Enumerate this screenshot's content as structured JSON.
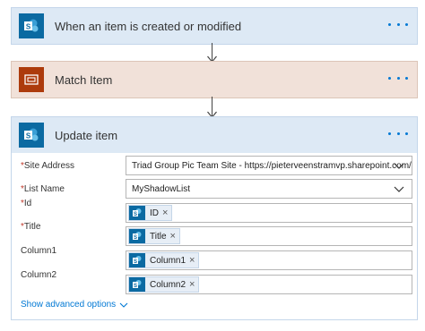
{
  "steps": {
    "trigger": {
      "title": "When an item is created or modified",
      "icon": "sharepoint-icon"
    },
    "match": {
      "title": "Match Item",
      "icon": "scope-icon"
    },
    "update": {
      "title": "Update item",
      "icon": "sharepoint-icon",
      "fields": {
        "site_address": {
          "label": "Site Address",
          "required": "*",
          "value": "Triad Group Pic Team Site - https://pieterveenstramvp.sharepoint.com/"
        },
        "list_name": {
          "label": "List Name",
          "required": "*",
          "value": "MyShadowList"
        },
        "id": {
          "label": "Id",
          "required": "*",
          "token": "ID"
        },
        "title": {
          "label": "Title",
          "required": "*",
          "token": "Title"
        },
        "column1": {
          "label": "Column1",
          "token": "Column1"
        },
        "column2": {
          "label": "Column2",
          "token": "Column2"
        }
      },
      "advanced_label": "Show advanced options"
    }
  },
  "colors": {
    "sharepoint": "#0b6aa2",
    "scope": "#ad3b0c",
    "accent": "#0078d4",
    "required": "#c0392b"
  }
}
